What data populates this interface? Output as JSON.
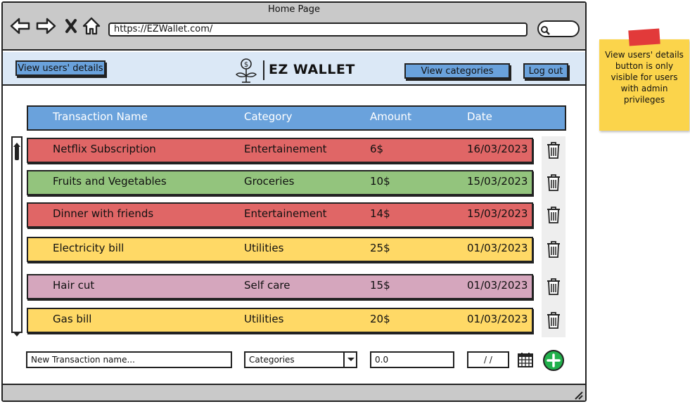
{
  "window": {
    "title": "Home Page"
  },
  "browser": {
    "url": "https://EZWallet.com/"
  },
  "header": {
    "view_users_label": "View users' details",
    "logo_text": "EZ WALLET",
    "view_categories_label": "View categories",
    "logout_label": "Log out"
  },
  "table": {
    "columns": [
      "Transaction Name",
      "Category",
      "Amount",
      "Date"
    ],
    "rows": [
      {
        "name": "Netflix Subscription",
        "category": "Entertainement",
        "amount": "6$",
        "date": "16/03/2023",
        "color": "#e06666"
      },
      {
        "name": "Fruits and Vegetables",
        "category": "Groceries",
        "amount": "10$",
        "date": "15/03/2023",
        "color": "#93c47d"
      },
      {
        "name": "Dinner with friends",
        "category": "Entertainement",
        "amount": "14$",
        "date": "15/03/2023",
        "color": "#e06666"
      },
      {
        "name": "Electricity bill",
        "category": "Utilities",
        "amount": "25$",
        "date": "01/03/2023",
        "color": "#ffd966"
      },
      {
        "name": "Hair cut",
        "category": "Self care",
        "amount": "15$",
        "date": "01/03/2023",
        "color": "#d5a6bd"
      },
      {
        "name": "Gas bill",
        "category": "Utilities",
        "amount": "20$",
        "date": "01/03/2023",
        "color": "#ffd966"
      }
    ]
  },
  "form": {
    "name_placeholder": "New Transaction name...",
    "category_value": "Categories",
    "amount_value": "0.0",
    "date_value": "/ /"
  },
  "note": {
    "text": "View users' details button is only visible for users with admin privileges"
  },
  "colors": {
    "accent": "#6aa2dc",
    "header_bg": "#dbe8f6",
    "add": "#21b04b",
    "note": "#fbd44b"
  }
}
